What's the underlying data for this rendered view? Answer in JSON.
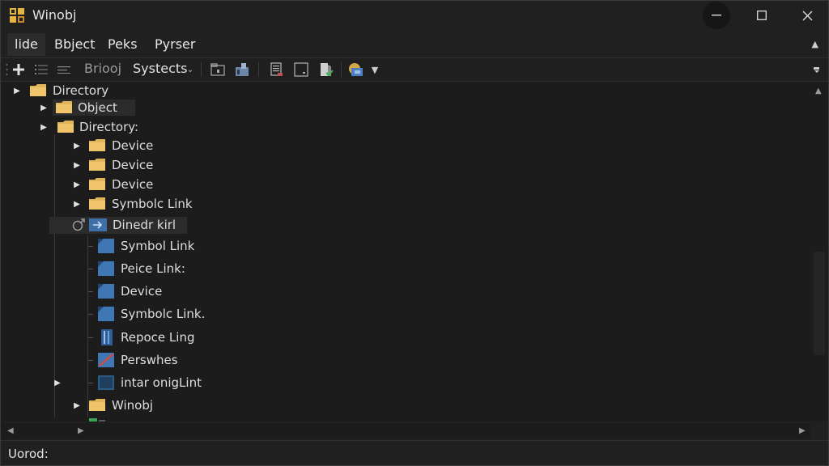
{
  "window": {
    "title": "Winobj"
  },
  "menu": {
    "items": [
      "lide",
      "Bbject",
      "Peks",
      "Pyrser"
    ]
  },
  "toolbar": {
    "label_a": "Briooj",
    "label_b": "Systects"
  },
  "tree": {
    "root": "Directory",
    "object": "Object",
    "dir2": "Directory:",
    "device1": "Device",
    "device2": "Device",
    "device3": "Device",
    "symlink1": "Symbolc Link",
    "selected": "Dinedr kirl",
    "child1": "Symbol Link",
    "child2": "Peice Link:",
    "child3": "Device",
    "child4": "Symbolc Link.",
    "child5": "Repoce Ling",
    "child6": "Perswhes",
    "child7": "intar onigLint",
    "winobj": "Winobj"
  },
  "status": {
    "text": "Uorod:"
  }
}
